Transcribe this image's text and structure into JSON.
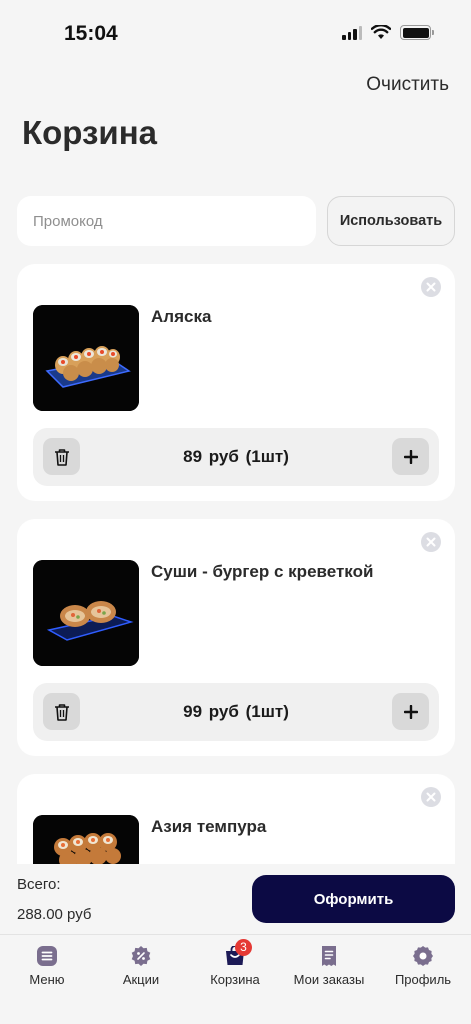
{
  "status_bar": {
    "time": "15:04"
  },
  "header": {
    "clear_label": "Очистить",
    "title": "Корзина"
  },
  "promo": {
    "placeholder": "Промокод",
    "button_label": "Использовать"
  },
  "cart_items": [
    {
      "name": "Аляска",
      "price": "89 руб",
      "quantity": "(1шт)"
    },
    {
      "name": "Суши - бургер с креветкой",
      "price": "99 руб",
      "quantity": "(1шт)"
    },
    {
      "name": "Азия темпура",
      "price": "",
      "quantity": ""
    }
  ],
  "summary": {
    "total_label": "Всего:",
    "total_value": "288.00 руб",
    "checkout_label": "Оформить"
  },
  "tab_bar": {
    "active_color": "#1c1a56",
    "icon_color": "#7a6e8e",
    "tabs": [
      {
        "label": "Меню",
        "icon": "menu-icon"
      },
      {
        "label": "Акции",
        "icon": "discount-icon"
      },
      {
        "label": "Корзина",
        "icon": "cart-icon",
        "badge": "3"
      },
      {
        "label": "Мои заказы",
        "icon": "receipt-icon"
      },
      {
        "label": "Профиль",
        "icon": "profile-icon"
      }
    ]
  }
}
